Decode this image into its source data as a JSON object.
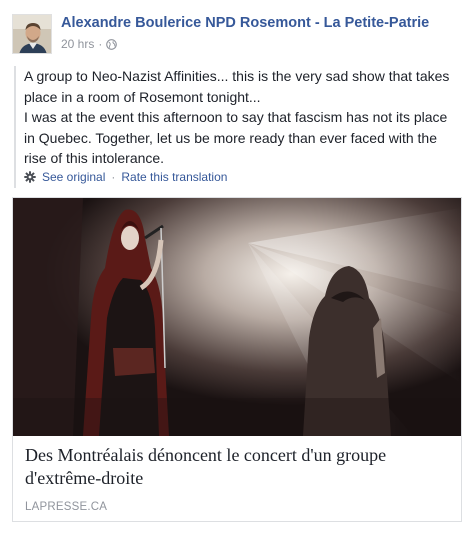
{
  "post": {
    "author": "Alexandre Boulerice NPD Rosemont - La Petite-Patrie",
    "timestamp": "20 hrs",
    "privacy_icon": "globe-icon",
    "paragraph1": "A group to Neo-Nazist Affinities... this is the very sad show that takes place in a room of Rosemont tonight...",
    "paragraph2": "I was at the event this afternoon to say that fascism has not its place in Quebec. Together, let us be more ready than ever faced with the rise of this intolerance.",
    "translation": {
      "icon": "gear-icon",
      "see_original": "See original",
      "separator": "·",
      "rate": "Rate this translation"
    }
  },
  "link_card": {
    "title": "Des Montréalais dénoncent le concert d'un groupe d'extrême-droite",
    "source": "LAPRESSE.CA"
  },
  "colors": {
    "link": "#365899",
    "meta": "#90949c",
    "text": "#1d2129"
  }
}
